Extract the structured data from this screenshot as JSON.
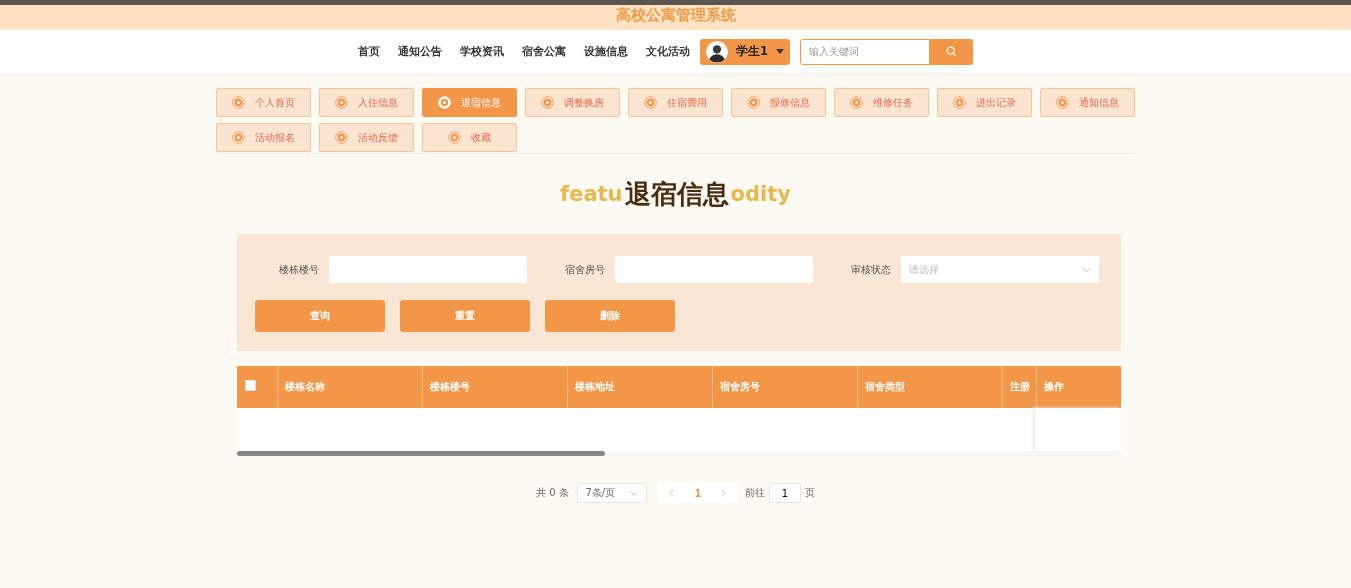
{
  "site_title": "高校公寓管理系统",
  "nav": [
    {
      "label": "首页"
    },
    {
      "label": "通知公告"
    },
    {
      "label": "学校资讯"
    },
    {
      "label": "宿舍公寓"
    },
    {
      "label": "设施信息"
    },
    {
      "label": "文化活动"
    }
  ],
  "user": {
    "name": "学生1"
  },
  "search": {
    "placeholder": "输入关键词"
  },
  "tabs": [
    {
      "label": "个人首页",
      "selected": false
    },
    {
      "label": "入住信息",
      "selected": false
    },
    {
      "label": "退宿信息",
      "selected": true
    },
    {
      "label": "调整换房",
      "selected": false
    },
    {
      "label": "住宿费用",
      "selected": false
    },
    {
      "label": "报修信息",
      "selected": false
    },
    {
      "label": "维修任务",
      "selected": false
    },
    {
      "label": "进出记录",
      "selected": false
    },
    {
      "label": "通知信息",
      "selected": false
    },
    {
      "label": "活动报名",
      "selected": false
    },
    {
      "label": "活动反馈",
      "selected": false
    },
    {
      "label": "收藏",
      "selected": false
    }
  ],
  "page_title": {
    "bg_left": "featu",
    "main": "退宿信息",
    "bg_right": "odity"
  },
  "filters": [
    {
      "kind": "text",
      "label": "楼栋楼号"
    },
    {
      "kind": "text",
      "label": "宿舍房号"
    },
    {
      "kind": "select",
      "label": "审核状态",
      "placeholder": "请选择"
    }
  ],
  "actions": [
    "查询",
    "重置",
    "删除"
  ],
  "table": {
    "select_all": {
      "checked": false
    },
    "columns": [
      "楼栋名称",
      "楼栋楼号",
      "楼栋地址",
      "宿舍房号",
      "宿舍类型",
      "注册"
    ],
    "fixed_column": "操作"
  },
  "pagination": {
    "total": "共 0 条",
    "page_size": "7条/页",
    "pages": [
      {
        "label": "1",
        "selected": true
      }
    ],
    "goto_label": "前往",
    "goto_value": "1",
    "goto_suffix": "页"
  }
}
